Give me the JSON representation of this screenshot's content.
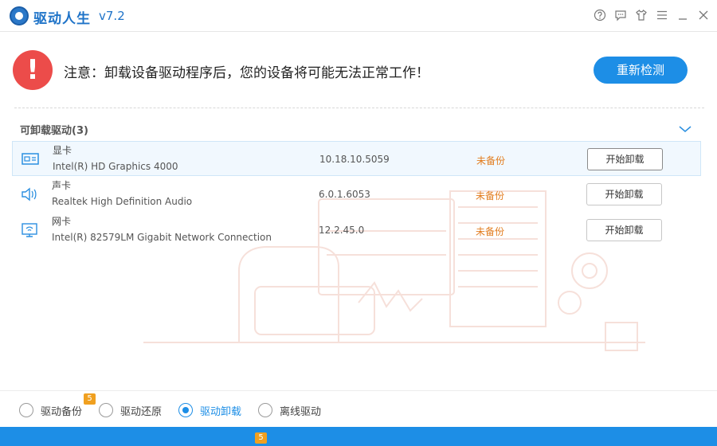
{
  "app": {
    "title": "驱动人生",
    "version": "v7.2",
    "window_icons": [
      "help-icon",
      "feedback-icon",
      "skin-icon",
      "menu-icon",
      "minimize-icon",
      "close-icon"
    ]
  },
  "warning": {
    "icon_text": "!",
    "message": "注意：卸载设备驱动程序后，您的设备将可能无法正常工作！",
    "rescan_label": "重新检测"
  },
  "section": {
    "title": "可卸载驱动(3)"
  },
  "drivers": [
    {
      "type": "显卡",
      "name": "Intel(R) HD Graphics 4000",
      "version": "10.18.10.5059",
      "status": "未备份",
      "action": "开始卸载",
      "icon": "graphics-card-icon",
      "selected": true
    },
    {
      "type": "声卡",
      "name": "Realtek High Definition Audio",
      "version": "6.0.1.6053",
      "status": "未备份",
      "action": "开始卸载",
      "icon": "speaker-icon",
      "selected": false
    },
    {
      "type": "网卡",
      "name": "Intel(R) 82579LM Gigabit Network Connection",
      "version": "12.2.45.0",
      "status": "未备份",
      "action": "开始卸载",
      "icon": "network-card-icon",
      "selected": false
    }
  ],
  "bottom_tabs": [
    {
      "label": "驱动备份",
      "badge": "5",
      "active": false
    },
    {
      "label": "驱动还原",
      "active": false
    },
    {
      "label": "驱动卸载",
      "active": true
    },
    {
      "label": "离线驱动",
      "active": false
    }
  ],
  "bottom_strip_badge": "5",
  "colors": {
    "accent": "#1d8ee6",
    "warning": "#ec4c4a",
    "status_orange": "#e27c1e",
    "badge": "#f0a020"
  }
}
